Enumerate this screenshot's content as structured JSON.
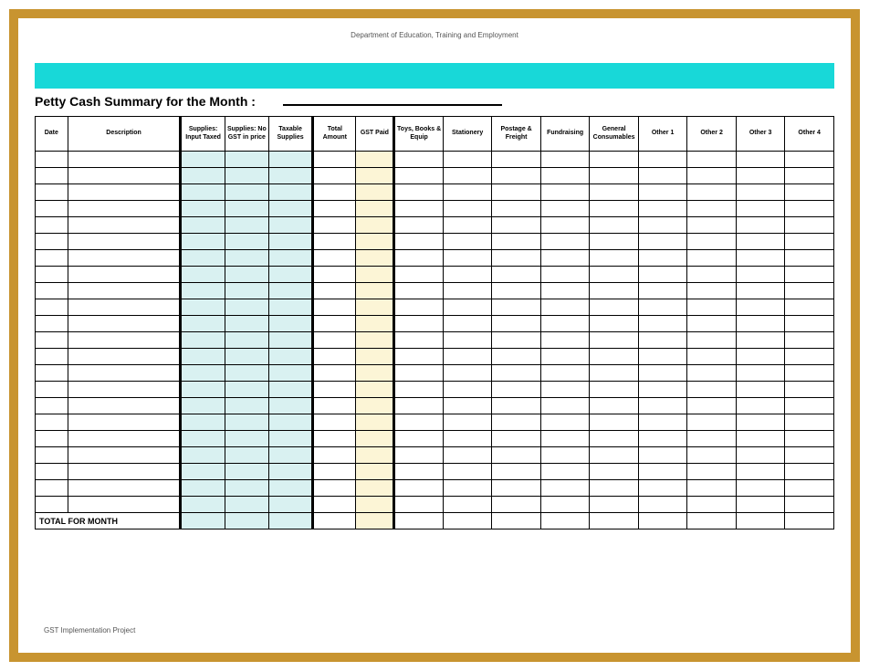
{
  "header": "Department of Education, Training and Employment",
  "title": "Petty Cash Summary for the Month :",
  "columns": {
    "date": "Date",
    "description": "Description",
    "supplies_input_taxed": "Supplies: Input Taxed",
    "supplies_no_gst": "Supplies: No GST in price",
    "taxable_supplies": "Taxable Supplies",
    "total_amount": "Total Amount",
    "gst_paid": "GST Paid",
    "toys_books_equip": "Toys, Books & Equip",
    "stationery": "Stationery",
    "postage_freight": "Postage & Freight",
    "fundraising": "Fundraising",
    "general_consumables": "General Consumables",
    "other1": "Other 1",
    "other2": "Other 2",
    "other3": "Other 3",
    "other4": "Other 4"
  },
  "total_row_label": "TOTAL FOR MONTH",
  "body_row_count": 22,
  "footer": "GST Implementation Project"
}
